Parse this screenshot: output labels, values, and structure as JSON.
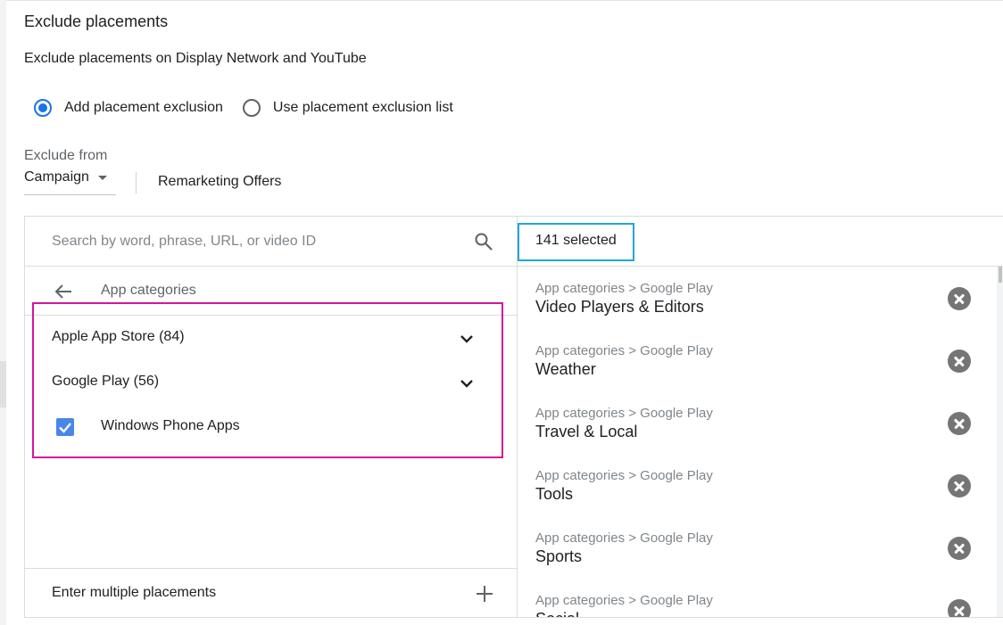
{
  "header": {
    "title": "Exclude placements",
    "subtitle": "Exclude placements on Display Network and YouTube"
  },
  "mode": {
    "options": [
      {
        "label": "Add placement exclusion",
        "selected": true
      },
      {
        "label": "Use placement exclusion list",
        "selected": false
      }
    ]
  },
  "exclude_from": {
    "label": "Exclude from",
    "value": "Campaign",
    "campaign_name": "Remarketing Offers"
  },
  "search": {
    "placeholder": "Search by word, phrase, URL, or video ID",
    "value": "",
    "icon": "search-icon"
  },
  "browse": {
    "back_icon": "arrow-back-icon",
    "breadcrumb": "App categories",
    "items": [
      {
        "label": "Apple App Store (84)",
        "type": "expandable"
      },
      {
        "label": "Google Play (56)",
        "type": "expandable"
      },
      {
        "label": "Windows Phone Apps",
        "type": "checkbox",
        "checked": true
      }
    ],
    "enter_multiple": "Enter multiple placements"
  },
  "selected": {
    "count_label": "141 selected",
    "items": [
      {
        "path": "App categories > Google Play",
        "name": "Video Players & Editors"
      },
      {
        "path": "App categories > Google Play",
        "name": "Weather"
      },
      {
        "path": "App categories > Google Play",
        "name": "Travel & Local"
      },
      {
        "path": "App categories > Google Play",
        "name": "Tools"
      },
      {
        "path": "App categories > Google Play",
        "name": "Sports"
      },
      {
        "path": "App categories > Google Play",
        "name": "Social"
      }
    ]
  },
  "colors": {
    "accent": "#1a73e8",
    "checkbox": "#4a86e8",
    "annotation_pink": "#d4159b",
    "annotation_blue": "#1fa8d4"
  }
}
